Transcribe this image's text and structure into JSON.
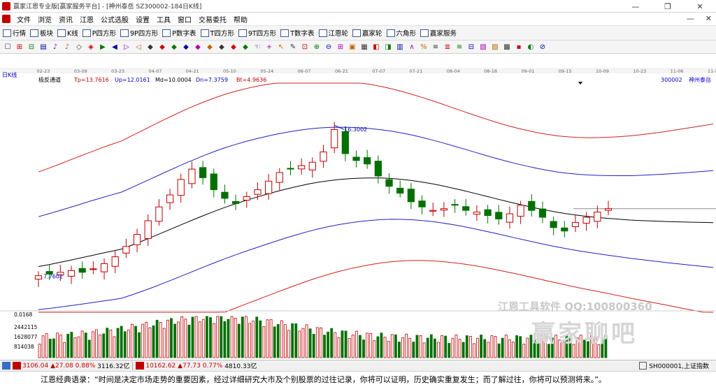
{
  "window": {
    "title": "赢家江恩专业版[赢家服务平台] - [神州泰岳  SZ300002-184日K线]",
    "min_glyph": "—",
    "max_glyph": "❐",
    "close_glyph": "✕"
  },
  "menu": [
    "文件",
    "浏览",
    "资讯",
    "江恩",
    "公式选股",
    "设置",
    "工具",
    "窗口",
    "交易委托",
    "帮助"
  ],
  "toolbar1": [
    {
      "label": "行情",
      "icon": "grid-icon"
    },
    {
      "label": "板块",
      "icon": "block-icon"
    },
    {
      "label": "K线",
      "icon": "kline-icon"
    },
    {
      "label": "P四方形",
      "icon": "square-icon"
    },
    {
      "label": "9P四方形",
      "icon": "square-icon"
    },
    {
      "label": "P数字表",
      "icon": "table-icon"
    },
    {
      "label": "T四方形",
      "icon": "square-icon"
    },
    {
      "label": "9T四方形",
      "icon": "square-icon"
    },
    {
      "label": "T数字表",
      "icon": "table-icon"
    },
    {
      "label": "江恩轮",
      "icon": "wheel-icon"
    },
    {
      "label": "赢家轮",
      "icon": "wheel-icon"
    },
    {
      "label": "六角形",
      "icon": "hexagon-icon"
    },
    {
      "label": "赢家服务",
      "icon": "service-icon"
    }
  ],
  "toolbar2_glyphs": [
    "☐",
    "⊞",
    "⊟",
    "▤",
    "♪",
    "♪",
    "◇",
    "◈",
    "▶",
    "◀",
    "▷",
    "◁",
    "◆",
    "◆",
    "◆",
    "◆",
    "◆",
    "◆",
    "◆",
    "◆",
    "◆",
    "☜",
    "+",
    "↖",
    "✎",
    "⊡",
    "⊕",
    "⊖",
    "⊞",
    "▣",
    "▦",
    "◧",
    "◨",
    "▥",
    "∧",
    "%",
    "≡",
    "≣",
    "≋",
    "⊟",
    "▧",
    "▨",
    "▩",
    "▪",
    "◐",
    "⊘"
  ],
  "chart": {
    "period_label": "日K线",
    "indicator_name": "极反通道",
    "indicator_values": [
      {
        "label": "Tp=13.7616",
        "color": "#c00000"
      },
      {
        "label": "Up=12.0161",
        "color": "#0000c0"
      },
      {
        "label": "Md=10.0004",
        "color": "#000000"
      },
      {
        "label": "Dn=7.3759",
        "color": "#0000c0"
      },
      {
        "label": "Bt=4.9636",
        "color": "#c00000"
      }
    ],
    "stock_code": "300002",
    "stock_name": "神州泰岳",
    "date_ticks": [
      "02-23",
      "03-09",
      "03-23",
      "04-07",
      "04-21",
      "05-10",
      "05-24",
      "06-07",
      "06-21",
      "07-07",
      "07-21",
      "08-04",
      "08-18",
      "09-01",
      "09-15",
      "10-09",
      "10-23",
      "11-06",
      "11-20"
    ],
    "high_label": "16.3002",
    "low_label": "7.7602",
    "volume_top_label": "0.0168",
    "volume_ticks": [
      "2442115",
      "1628077",
      "814038"
    ],
    "colors": {
      "up": "#c00000",
      "down": "#007000",
      "channel_outer": "#d02020",
      "channel_inner": "#2020c0",
      "mid": "#000000"
    }
  },
  "chart_data": {
    "type": "candlestick",
    "title": "神州泰岳 SZ300002 日K线",
    "x_labels": [
      "02-23",
      "03-09",
      "03-23",
      "04-07",
      "04-21",
      "05-10",
      "05-24",
      "06-07",
      "06-21",
      "07-07",
      "07-21",
      "08-04",
      "08-18",
      "09-01",
      "09-15",
      "10-09",
      "10-23",
      "11-06",
      "11-20"
    ],
    "y_range": [
      6.0,
      19.0
    ],
    "close_series": [
      7.8,
      7.9,
      8.0,
      8.1,
      8.0,
      8.2,
      8.5,
      8.9,
      9.5,
      10.2,
      11.0,
      11.8,
      12.5,
      13.4,
      14.0,
      13.5,
      12.8,
      12.3,
      12.0,
      12.4,
      12.8,
      13.3,
      13.8,
      14.0,
      14.2,
      14.4,
      15.0,
      16.3,
      14.9,
      14.5,
      14.3,
      13.6,
      13.0,
      12.6,
      12.1,
      11.8,
      11.6,
      11.7,
      11.9,
      11.6,
      11.5,
      11.3,
      11.1,
      11.4,
      11.9,
      11.6,
      11.2,
      10.6,
      10.4,
      10.9,
      11.2,
      11.5,
      11.7
    ]
  },
  "statusbar": {
    "sh_index": "3106.04",
    "sh_change": "▲27.08",
    "sh_pct": "0.88%",
    "sh_amount": "3116.32亿",
    "sz_index": "10162.62",
    "sz_change": "▲77.73",
    "sz_pct": "0.77%",
    "sz_amount": "4810.33亿",
    "right_code": "SH000001,上证指数"
  },
  "watermark": {
    "ad": "江恩工具软件  QQ:100800360",
    "brand": "赢家聊吧"
  },
  "quote": "江恩经典语录：“时间是决定市场走势的重要因素，经过详细研究大市及个别股票的过往记录，你将可以证明，历史确实重复发生；而了解过往，你将可以预测将来。”。"
}
